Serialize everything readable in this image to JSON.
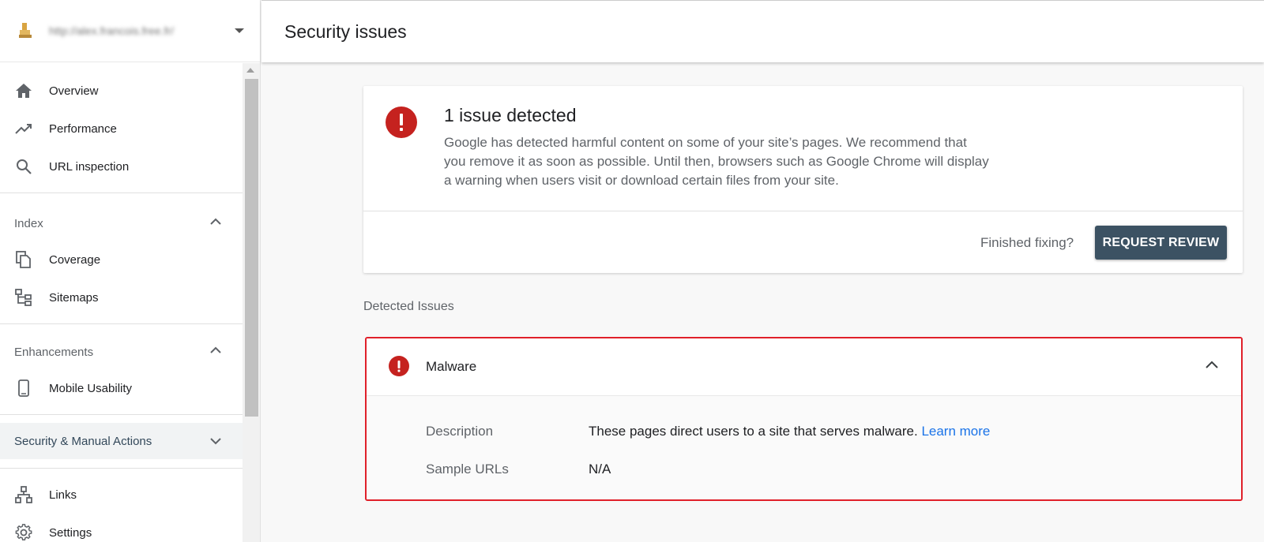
{
  "property": {
    "url": "http://alex.francois.free.fr/"
  },
  "sidebar": {
    "items": [
      {
        "label": "Overview",
        "icon": "home-icon"
      },
      {
        "label": "Performance",
        "icon": "trending-up-icon"
      },
      {
        "label": "URL inspection",
        "icon": "search-icon"
      }
    ],
    "sections": [
      {
        "label": "Index",
        "items": [
          {
            "label": "Coverage",
            "icon": "coverage-icon"
          },
          {
            "label": "Sitemaps",
            "icon": "sitemap-icon"
          }
        ]
      },
      {
        "label": "Enhancements",
        "items": [
          {
            "label": "Mobile Usability",
            "icon": "mobile-icon"
          }
        ]
      }
    ],
    "active_section": "Security & Manual Actions",
    "bottom_items": [
      {
        "label": "Links",
        "icon": "links-icon"
      },
      {
        "label": "Settings",
        "icon": "gear-icon"
      }
    ]
  },
  "header": {
    "title": "Security issues"
  },
  "summary": {
    "heading": "1 issue detected",
    "description": "Google has detected harmful content on some of your site’s pages. We recommend that you remove it as soon as possible. Until then, browsers such as Google Chrome will display a warning when users visit or download certain files from your site.",
    "finished_label": "Finished fixing?",
    "button_label": "REQUEST REVIEW"
  },
  "detected": {
    "label": "Detected Issues",
    "issue_name": "Malware",
    "description_key": "Description",
    "description_value": "These pages direct users to a site that serves malware.",
    "learn_more": "Learn more",
    "sample_urls_key": "Sample URLs",
    "sample_urls_value": "N/A"
  },
  "colors": {
    "error_red": "#c5221f",
    "highlight_border": "#e0202a",
    "button_bg": "#3c5263",
    "link": "#1a73e8"
  }
}
